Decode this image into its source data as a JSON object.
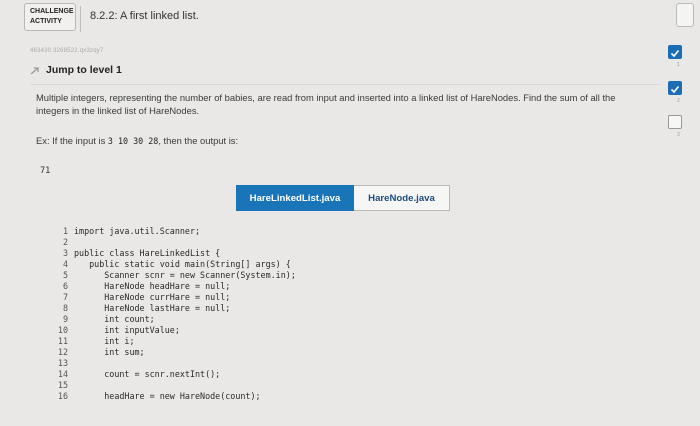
{
  "header": {
    "badge_line1": "CHALLENGE",
    "badge_line2": "ACTIVITY",
    "title": "8.2.2: A first linked list."
  },
  "activity_id": "463430.3268522.qx3zqy7",
  "jump": {
    "label": "Jump to level 1"
  },
  "prompt": {
    "description": "Multiple integers, representing the number of babies, are read from input and inserted into a linked list of HareNodes. Find the sum of all the integers in the linked list of HareNodes.",
    "example_prefix": "Ex: If the input is",
    "example_input": "3 10 30 28",
    "example_middle": ", then the output is:",
    "output": "71"
  },
  "tabs": [
    {
      "label": "HareLinkedList.java",
      "active": true
    },
    {
      "label": "HareNode.java",
      "active": false
    }
  ],
  "code_lines": [
    {
      "num": "1",
      "text": "import java.util.Scanner;"
    },
    {
      "num": "2",
      "text": ""
    },
    {
      "num": "3",
      "text": "public class HareLinkedList {"
    },
    {
      "num": "4",
      "text": "   public static void main(String[] args) {"
    },
    {
      "num": "5",
      "text": "      Scanner scnr = new Scanner(System.in);"
    },
    {
      "num": "6",
      "text": "      HareNode headHare = null;"
    },
    {
      "num": "7",
      "text": "      HareNode currHare = null;"
    },
    {
      "num": "8",
      "text": "      HareNode lastHare = null;"
    },
    {
      "num": "9",
      "text": "      int count;"
    },
    {
      "num": "10",
      "text": "      int inputValue;"
    },
    {
      "num": "11",
      "text": "      int i;"
    },
    {
      "num": "12",
      "text": "      int sum;"
    },
    {
      "num": "13",
      "text": ""
    },
    {
      "num": "14",
      "text": "      count = scnr.nextInt();"
    },
    {
      "num": "15",
      "text": ""
    },
    {
      "num": "16",
      "text": "      headHare = new HareNode(count);"
    }
  ],
  "levels": [
    {
      "num": "1",
      "status": "done"
    },
    {
      "num": "2",
      "status": "done"
    },
    {
      "num": "3",
      "status": "todo"
    }
  ],
  "colors": {
    "accent": "#1a74b8",
    "check": "#1b6db4",
    "background": "#e9e8e6"
  }
}
